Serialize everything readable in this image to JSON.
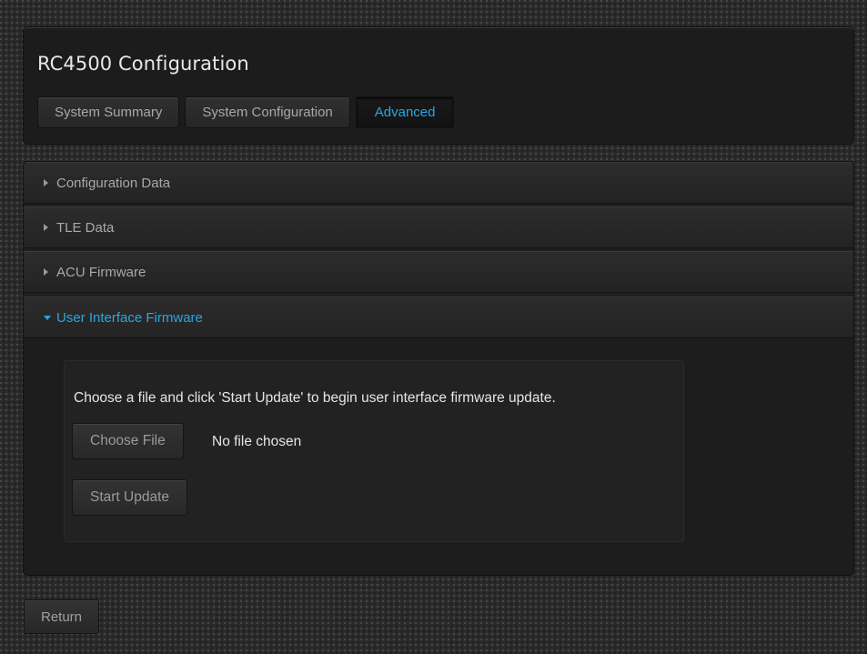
{
  "app": {
    "title": "RC4500 Configuration"
  },
  "tabs": [
    {
      "label": "System Summary",
      "active": false
    },
    {
      "label": "System Configuration",
      "active": false
    },
    {
      "label": "Advanced",
      "active": true
    }
  ],
  "sections": [
    {
      "label": "Configuration Data",
      "expanded": false
    },
    {
      "label": "TLE Data",
      "expanded": false
    },
    {
      "label": "ACU Firmware",
      "expanded": false
    },
    {
      "label": "User Interface Firmware",
      "expanded": true
    }
  ],
  "ui_firmware": {
    "instructions": "Choose a file and click 'Start Update' to begin user interface firmware update.",
    "choose_file_label": "Choose File",
    "file_status": "No file chosen",
    "start_update_label": "Start Update"
  },
  "footer": {
    "return_label": "Return"
  },
  "colors": {
    "accent": "#2aa6e0",
    "panel_bg": "#1c1c1c",
    "text": "#e6e6e6",
    "muted_text": "#a9a9a9"
  },
  "icons": {
    "collapsed": "caret-right-icon",
    "expanded": "caret-down-icon"
  }
}
